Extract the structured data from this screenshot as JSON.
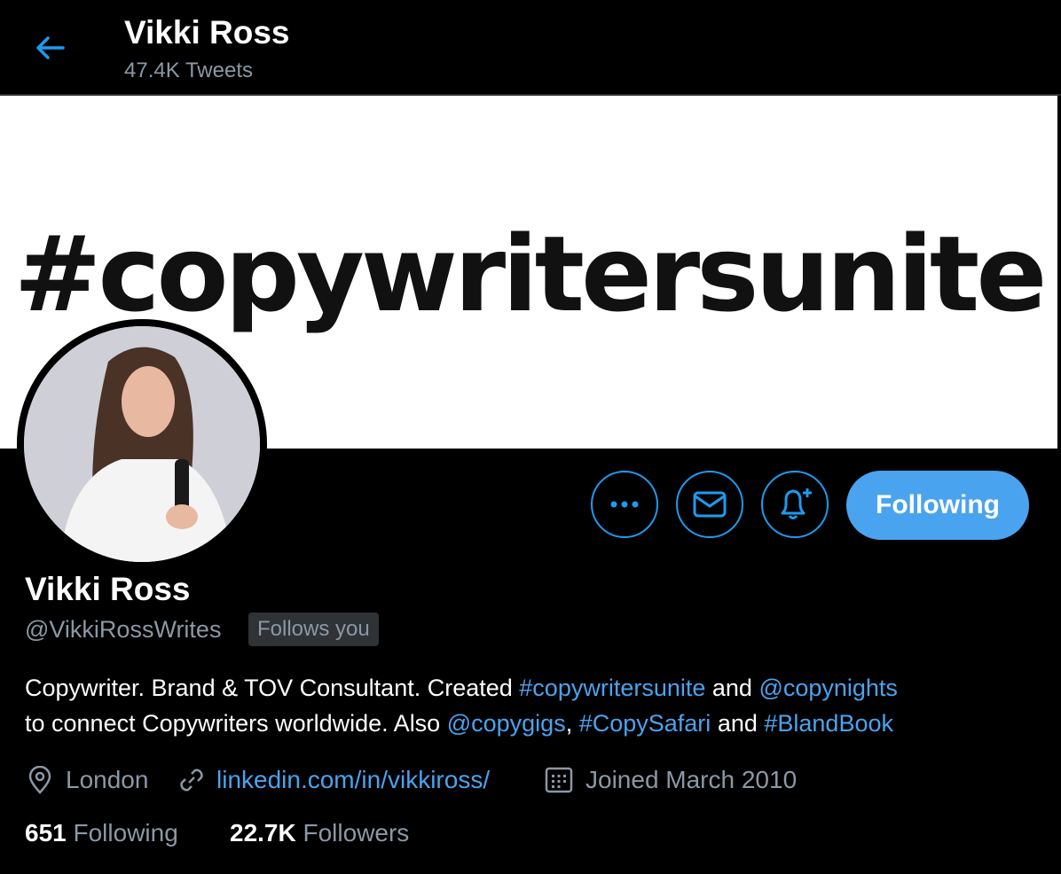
{
  "header": {
    "title": "Vikki Ross",
    "tweets_count": "47.4K Tweets",
    "back_icon": "arrow-left-icon"
  },
  "banner": {
    "text": "#copywritersunite"
  },
  "actions": {
    "more_icon": "more-dots-icon",
    "message_icon": "envelope-icon",
    "notify_icon": "bell-plus-icon",
    "following_label": "Following"
  },
  "profile": {
    "name": "Vikki Ross",
    "handle": "@VikkiRossWrites",
    "follows_you": "Follows you",
    "bio": {
      "part1": "Copywriter. Brand & TOV Consultant. Created ",
      "link1": "#copywritersunite",
      "part2": " and ",
      "link2": "@copynights",
      "part3": "to connect Copywriters worldwide. Also ",
      "link3": "@copygigs",
      "part4": ", ",
      "link4": "#CopySafari",
      "part5": " and ",
      "link5": "#BlandBook"
    },
    "location": "London",
    "website": "linkedin.com/in/vikkiross/",
    "joined": "Joined March 2010",
    "following_count": "651",
    "following_label": "Following",
    "followers_count": "22.7K",
    "followers_label": "Followers"
  },
  "colors": {
    "accent": "#1d9bf0",
    "background": "#000000",
    "secondary_text": "#8b98a5"
  }
}
